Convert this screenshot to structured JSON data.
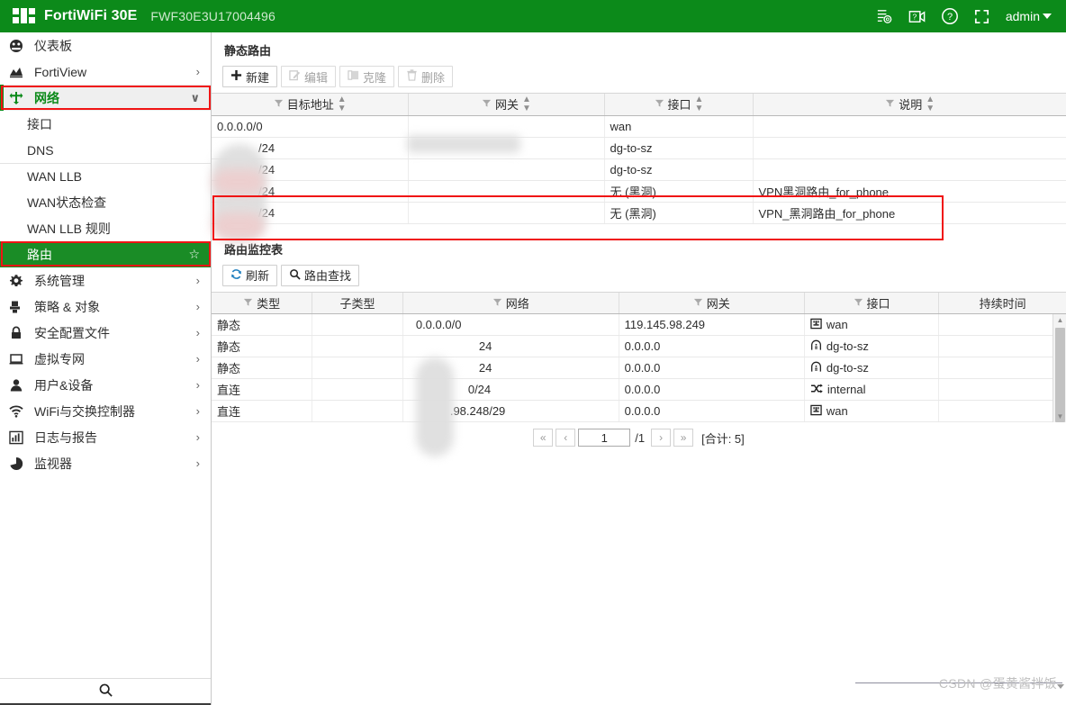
{
  "topbar": {
    "brand": "FortiWiFi 30E",
    "serial": "FWF30E3U17004496",
    "admin_label": "admin",
    "icons": [
      {
        "name": "system-config-icon",
        "glyph": "config"
      },
      {
        "name": "video-tutorial-icon",
        "glyph": "video"
      },
      {
        "name": "help-icon",
        "glyph": "question"
      },
      {
        "name": "fullscreen-icon",
        "glyph": "fullscreen"
      }
    ],
    "brand_color": "#0c8a1a"
  },
  "sidebar": {
    "items": [
      {
        "label": "仪表板",
        "icon": "dashboard-icon",
        "chevron": "",
        "state": "normal"
      },
      {
        "label": "FortiView",
        "icon": "fortiview-icon",
        "chevron": "›",
        "state": "normal"
      },
      {
        "label": "网络",
        "icon": "network-icon",
        "chevron": "∨",
        "state": "expanded"
      },
      {
        "label": "系统管理",
        "icon": "system-gear-icon",
        "chevron": "›",
        "state": "normal"
      },
      {
        "label": "策略 & 对象",
        "icon": "policy-object-icon",
        "chevron": "›",
        "state": "normal"
      },
      {
        "label": "安全配置文件",
        "icon": "lock-icon",
        "chevron": "›",
        "state": "normal"
      },
      {
        "label": "虚拟专网",
        "icon": "vpn-monitor-icon",
        "chevron": "›",
        "state": "normal"
      },
      {
        "label": "用户&设备",
        "icon": "user-icon",
        "chevron": "›",
        "state": "normal"
      },
      {
        "label": "WiFi与交换控制器",
        "icon": "wifi-icon",
        "chevron": "›",
        "state": "normal"
      },
      {
        "label": "日志与报告",
        "icon": "log-report-icon",
        "chevron": "›",
        "state": "normal"
      },
      {
        "label": "监视器",
        "icon": "monitor-pie-icon",
        "chevron": "›",
        "state": "normal"
      }
    ],
    "network_subitems": [
      {
        "label": "接口",
        "active": false,
        "separator": false
      },
      {
        "label": "DNS",
        "active": false,
        "separator": false
      },
      {
        "label": "WAN LLB",
        "active": false,
        "separator": true
      },
      {
        "label": "WAN状态检查",
        "active": false,
        "separator": false
      },
      {
        "label": "WAN LLB 规则",
        "active": false,
        "separator": false
      },
      {
        "label": "路由",
        "active": true,
        "separator": false
      }
    ],
    "active_star": "☆",
    "search_icon": "search-icon"
  },
  "static_route": {
    "title": "静态路由",
    "toolbar": [
      {
        "label": "新建",
        "icon": "plus-icon",
        "disabled": false
      },
      {
        "label": "编辑",
        "icon": "edit-icon",
        "disabled": true
      },
      {
        "label": "克隆",
        "icon": "clone-icon",
        "disabled": true
      },
      {
        "label": "删除",
        "icon": "trash-icon",
        "disabled": true
      }
    ],
    "columns": [
      {
        "label": "目标地址",
        "filter": true,
        "sort": true
      },
      {
        "label": "网关",
        "filter": true,
        "sort": true
      },
      {
        "label": "接口",
        "filter": true,
        "sort": true
      },
      {
        "label": "说明",
        "filter": true,
        "sort": true
      }
    ],
    "rows": [
      {
        "destination": "0.0.0.0/0",
        "gateway": "",
        "interface": "wan",
        "description": ""
      },
      {
        "destination": "/24",
        "gateway": "",
        "interface": "dg-to-sz",
        "description": ""
      },
      {
        "destination": "/24",
        "gateway": "",
        "interface": "dg-to-sz",
        "description": ""
      },
      {
        "destination": "/24",
        "gateway": "",
        "interface": "无 (黑洞)",
        "description": "VPN黑洞路由_for_phone"
      },
      {
        "destination": "/24",
        "gateway": "",
        "interface": "无 (黑洞)",
        "description": "VPN_黑洞路由_for_phone"
      }
    ]
  },
  "routing_monitor": {
    "title": "路由监控表",
    "toolbar": [
      {
        "label": "刷新",
        "icon": "refresh-icon"
      },
      {
        "label": "路由查找",
        "icon": "search-icon"
      }
    ],
    "columns": [
      {
        "label": "类型",
        "filter": true
      },
      {
        "label": "子类型",
        "filter": false
      },
      {
        "label": "网络",
        "filter": true
      },
      {
        "label": "网关",
        "filter": true
      },
      {
        "label": "接口",
        "filter": true
      },
      {
        "label": "持续时间",
        "filter": false
      }
    ],
    "rows": [
      {
        "type": "静态",
        "subtype": "",
        "network": "0.0.0.0/0",
        "gateway": "119.145.98.249",
        "interface": "wan",
        "if_icon": "wan-port-icon",
        "duration": ""
      },
      {
        "type": "静态",
        "subtype": "",
        "network": "24",
        "gateway": "0.0.0.0",
        "interface": "dg-to-sz",
        "if_icon": "tunnel-icon",
        "duration": ""
      },
      {
        "type": "静态",
        "subtype": "",
        "network": "24",
        "gateway": "0.0.0.0",
        "interface": "dg-to-sz",
        "if_icon": "tunnel-icon",
        "duration": ""
      },
      {
        "type": "直连",
        "subtype": "",
        "network": "0/24",
        "gateway": "0.0.0.0",
        "interface": "internal",
        "if_icon": "switch-icon",
        "duration": ""
      },
      {
        "type": "直连",
        "subtype": "",
        "network": ".98.248/29",
        "gateway": "0.0.0.0",
        "interface": "wan",
        "if_icon": "wan-port-icon",
        "duration": ""
      }
    ],
    "pagination": {
      "first": "«",
      "prev": "‹",
      "page_value": "1",
      "page_of": "/1",
      "next": "›",
      "last": "»",
      "total": "[合计: 5]"
    }
  },
  "watermark": {
    "text": "CSDN @蛋黄酱拌饭"
  },
  "annotations": {
    "accent_color": "#f01414",
    "selected_color": "#1a8c26"
  }
}
